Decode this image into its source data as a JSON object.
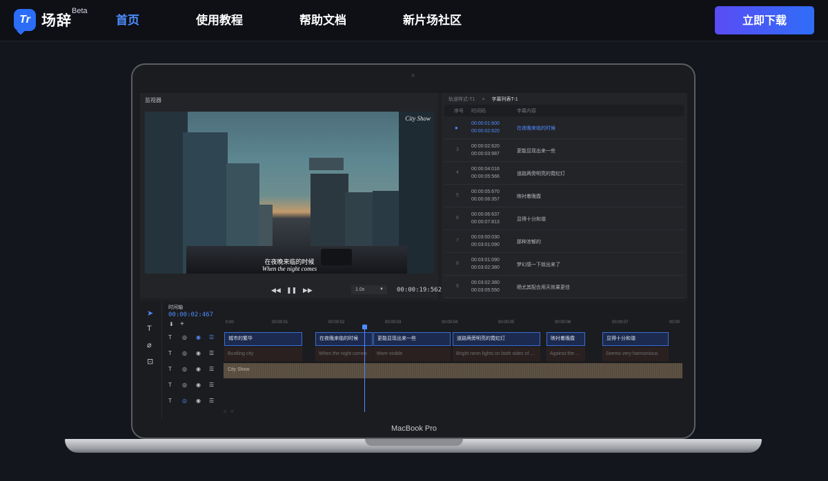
{
  "nav": {
    "logo_mark": "Tr",
    "logo_name": "场辞",
    "logo_beta": "Beta",
    "links": [
      "首页",
      "使用教程",
      "帮助文档",
      "新片场社区"
    ],
    "active_index": 0,
    "download_label": "立即下载",
    "accent": "#2f6df7"
  },
  "laptop": {
    "model_label": "MacBook Pro"
  },
  "monitor": {
    "title": "监视器",
    "watermark": "City Show",
    "subtitle_cn": "在夜晚来临的时候",
    "subtitle_en": "When the night comes",
    "speed": "1.0x",
    "timecode": "00:00:19:562"
  },
  "subtitle_list": {
    "tabs": [
      "轨道样式-T1",
      "×",
      "字幕列表T-1"
    ],
    "headers": [
      "序号",
      "时间码",
      "字幕内容"
    ],
    "rows": [
      {
        "num": "●",
        "start": "00:00:01:600",
        "end": "00:00:02:620",
        "text": "在夜晚来临的时候",
        "active": true
      },
      {
        "num": "3",
        "start": "00:00:02:620",
        "end": "00:00:03:987",
        "text": "更能显现出来一些"
      },
      {
        "num": "4",
        "start": "00:00:04:016",
        "end": "00:00:05:566",
        "text": "道路两旁明亮的霓虹灯"
      },
      {
        "num": "5",
        "start": "00:00:05:670",
        "end": "00:00:06:357",
        "text": "映衬着晚霞"
      },
      {
        "num": "6",
        "start": "00:00:06:637",
        "end": "00:00:07:813",
        "text": "显得十分和谐"
      },
      {
        "num": "7",
        "start": "00:03:00:030",
        "end": "00:03:01:090",
        "text": "那种浓郁的"
      },
      {
        "num": "8",
        "start": "00:03:01:090",
        "end": "00:03:02:380",
        "text": "梦幻感一下就出来了"
      },
      {
        "num": "9",
        "start": "00:03:02:380",
        "end": "00:03:05:550",
        "text": "晒尤其配合用天效果更佳"
      }
    ]
  },
  "timeline": {
    "label": "时间轴",
    "time": "00:00:02:467",
    "ruler": [
      "0:00",
      "00:00:01",
      "00:00:02",
      "00:00:03",
      "00:00:04",
      "00:00:05",
      "00:00:06",
      "00:00:07",
      "00:00"
    ],
    "clips_cn": [
      "城市的繁华",
      "在夜晚来临的时候",
      "更能显现出来一些",
      "道路两旁明亮的霓虹灯",
      "映衬着晚霞",
      "显得十分和谐"
    ],
    "clips_en": [
      "Bustling city",
      "When the night comes",
      "More visible",
      "Bright neon lights on both sides of ...",
      "Against the ...",
      "Seems very harmonious"
    ],
    "audio_label": "City Show",
    "tool_icons": [
      "cursor-icon",
      "text-icon",
      "eraser-icon",
      "text-box-icon"
    ],
    "track_controls": [
      "T",
      "◎",
      "◉",
      "☰"
    ]
  }
}
